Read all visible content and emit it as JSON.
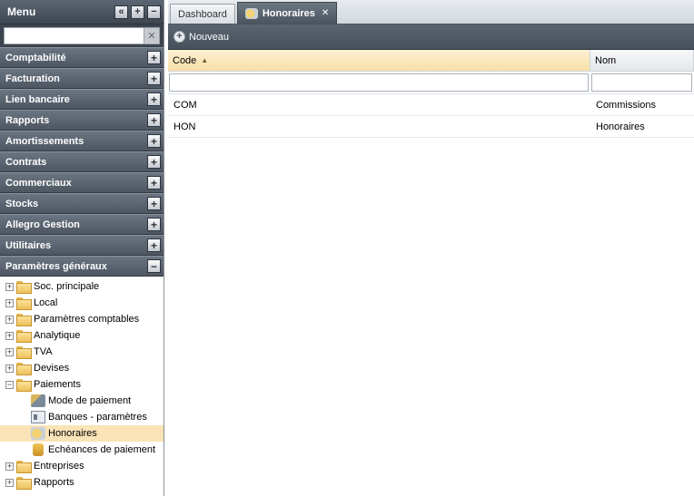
{
  "menu": {
    "title": "Menu",
    "collapse_icon": "double-chevron-left-icon",
    "expand_all_icon": "plus-icon",
    "collapse_all_icon": "minus-icon",
    "search": {
      "value": "",
      "placeholder": ""
    },
    "sections": [
      {
        "label": "Comptabilité",
        "expanded": false
      },
      {
        "label": "Facturation",
        "expanded": false
      },
      {
        "label": "Lien bancaire",
        "expanded": false
      },
      {
        "label": "Rapports",
        "expanded": false
      },
      {
        "label": "Amortissements",
        "expanded": false
      },
      {
        "label": "Contrats",
        "expanded": false
      },
      {
        "label": "Commerciaux",
        "expanded": false
      },
      {
        "label": "Stocks",
        "expanded": false
      },
      {
        "label": "Allegro Gestion",
        "expanded": false
      },
      {
        "label": "Utilitaires",
        "expanded": false
      },
      {
        "label": "Paramètres généraux",
        "expanded": true
      }
    ],
    "tree": [
      {
        "label": "Soc. principale",
        "icon": "folder-icon"
      },
      {
        "label": "Local",
        "icon": "folder-icon"
      },
      {
        "label": "Paramètres comptables",
        "icon": "folder-icon"
      },
      {
        "label": "Analytique",
        "icon": "folder-icon"
      },
      {
        "label": "TVA",
        "icon": "folder-icon"
      },
      {
        "label": "Devises",
        "icon": "folder-icon"
      },
      {
        "label": "Paiements",
        "icon": "open-folder-icon",
        "children": [
          {
            "label": "Mode de paiement",
            "icon": "payment-mode-icon"
          },
          {
            "label": "Banques - paramètres",
            "icon": "bank-card-icon"
          },
          {
            "label": "Honoraires",
            "icon": "fees-icon",
            "selected": true
          },
          {
            "label": "Echéances de paiement",
            "icon": "due-date-icon"
          }
        ]
      },
      {
        "label": "Entreprises",
        "icon": "folder-icon"
      },
      {
        "label": "Rapports",
        "icon": "folder-icon"
      }
    ]
  },
  "tabs": [
    {
      "label": "Dashboard",
      "active": false
    },
    {
      "label": "Honoraires",
      "active": true,
      "icon": "fees-icon",
      "closable": true
    }
  ],
  "toolbar": {
    "new_label": "Nouveau"
  },
  "grid": {
    "columns": [
      {
        "label": "Code",
        "sort": "asc"
      },
      {
        "label": "Nom"
      }
    ],
    "rows": [
      {
        "code": "COM",
        "nom": "Commissions"
      },
      {
        "code": "HON",
        "nom": "Honoraires"
      }
    ]
  },
  "colors": {
    "header_dark": "#4a535e",
    "selected_row": "#fae3b7",
    "sorted_header": "#f7dfa8"
  }
}
